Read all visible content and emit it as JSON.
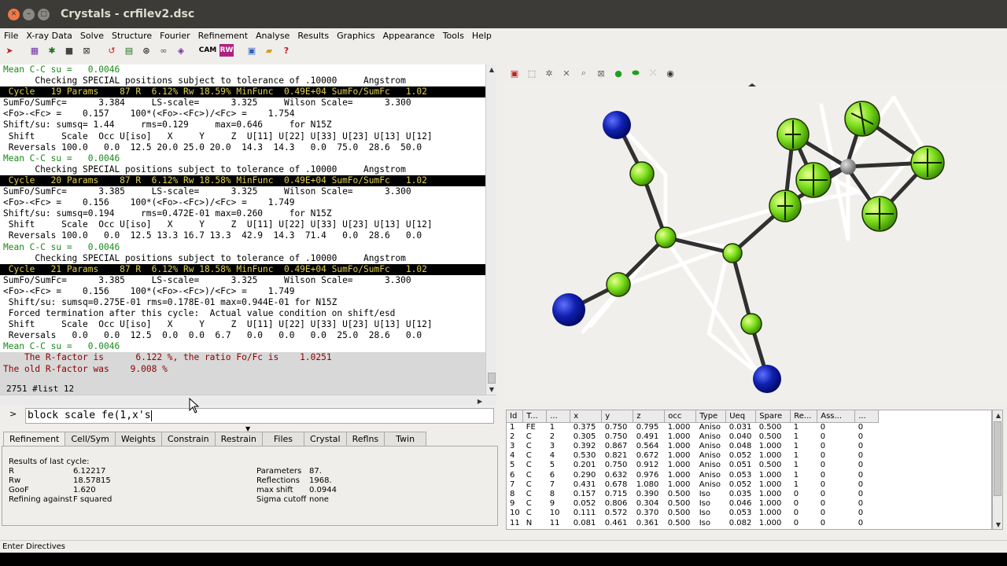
{
  "window": {
    "title": "Crystals - crfilev2.dsc"
  },
  "menu": [
    "File",
    "X-ray Data",
    "Solve",
    "Structure",
    "Fourier",
    "Refinement",
    "Analyse",
    "Results",
    "Graphics",
    "Appearance",
    "Tools",
    "Help"
  ],
  "toolbar_icons": [
    "arrow-icon",
    "grid-icon",
    "atoms-icon",
    "stop-icon",
    "cancel-icon",
    "undo-icon",
    "script-icon",
    "rings-icon",
    "link-icon",
    "molecule-icon",
    "cam-icon",
    "rw-icon",
    "view-icon",
    "folder-icon",
    "help-icon"
  ],
  "toolbar_text": {
    "cam": "CAM",
    "rw": "RW"
  },
  "output_lines": [
    {
      "t": "Mean C-C su =   0.0046",
      "c": "green"
    },
    {
      "t": "      Checking SPECIAL positions subject to tolerance of .10000     Angstrom",
      "c": ""
    },
    {
      "t": " Cycle   19 Params    87 R  6.12% Rw 18.59% MinFunc  0.49E+04 SumFo/SumFc   1.02",
      "c": "cycle"
    },
    {
      "t": "SumFo/SumFc=      3.384     LS-scale=      3.325     Wilson Scale=      3.300",
      "c": ""
    },
    {
      "t": "<Fo>-<Fc> =    0.157    100*(<Fo>-<Fc>)/<Fc> =    1.754",
      "c": ""
    },
    {
      "t": "Shift/su: sumsq= 1.44     rms=0.129     max=0.646     for N15Z",
      "c": ""
    },
    {
      "t": " Shift     Scale  Occ U[iso]   X     Y     Z  U[11] U[22] U[33] U[23] U[13] U[12]",
      "c": ""
    },
    {
      "t": " Reversals 100.0   0.0  12.5 20.0 25.0 20.0  14.3  14.3   0.0  75.0  28.6  50.0",
      "c": ""
    },
    {
      "t": "Mean C-C su =   0.0046",
      "c": "green"
    },
    {
      "t": "      Checking SPECIAL positions subject to tolerance of .10000     Angstrom",
      "c": ""
    },
    {
      "t": " Cycle   20 Params    87 R  6.12% Rw 18.58% MinFunc  0.49E+04 SumFo/SumFc   1.02",
      "c": "cycle"
    },
    {
      "t": "SumFo/SumFc=      3.385     LS-scale=      3.325     Wilson Scale=      3.300",
      "c": ""
    },
    {
      "t": "<Fo>-<Fc> =    0.156    100*(<Fo>-<Fc>)/<Fc> =    1.749",
      "c": ""
    },
    {
      "t": "Shift/su: sumsq=0.194     rms=0.472E-01 max=0.260     for N15Z",
      "c": ""
    },
    {
      "t": " Shift     Scale  Occ U[iso]   X     Y     Z  U[11] U[22] U[33] U[23] U[13] U[12]",
      "c": ""
    },
    {
      "t": " Reversals 100.0   0.0  12.5 13.3 16.7 13.3  42.9  14.3  71.4   0.0  28.6   0.0",
      "c": ""
    },
    {
      "t": "Mean C-C su =   0.0046",
      "c": "green"
    },
    {
      "t": "      Checking SPECIAL positions subject to tolerance of .10000     Angstrom",
      "c": ""
    },
    {
      "t": " Cycle   21 Params    87 R  6.12% Rw 18.58% MinFunc  0.49E+04 SumFo/SumFc   1.02",
      "c": "cycle"
    },
    {
      "t": "SumFo/SumFc=      3.385     LS-scale=      3.325     Wilson Scale=      3.300",
      "c": ""
    },
    {
      "t": "<Fo>-<Fc> =    0.156    100*(<Fo>-<Fc>)/<Fc> =    1.749",
      "c": ""
    },
    {
      "t": " Shift/su: sumsq=0.275E-01 rms=0.178E-01 max=0.944E-01 for N15Z",
      "c": ""
    },
    {
      "t": " Forced termination after this cycle:  Actual value condition on shift/esd",
      "c": ""
    },
    {
      "t": " Shift     Scale  Occ U[iso]   X     Y     Z  U[11] U[22] U[33] U[23] U[13] U[12]",
      "c": ""
    },
    {
      "t": " Reversals   0.0   0.0  12.5  0.0  0.0  6.7   0.0   0.0   0.0  25.0  28.6   0.0",
      "c": ""
    },
    {
      "t": "Mean C-C su =   0.0046",
      "c": "green"
    },
    {
      "t": "    The R-factor is      6.122 %, the ratio Fo/Fc is    1.0251",
      "c": "red"
    },
    {
      "t": "The old R-factor was    9.008 %",
      "c": "red"
    },
    {
      "t": "",
      "c": "gray"
    }
  ],
  "status_line": "2751 #list 12",
  "command": {
    "prompt": ">",
    "value": "block scale fe(1,x's"
  },
  "tabs": [
    "Refinement",
    "Cell/Sym",
    "Weights",
    "Constrain",
    "Restrain",
    "Files",
    "Crystal",
    "Reflns",
    "Twin"
  ],
  "results": {
    "title": "Results of last cycle:",
    "left": [
      {
        "k": "R",
        "v": "6.12217"
      },
      {
        "k": "Rw",
        "v": "18.57815"
      },
      {
        "k": "GooF",
        "v": "1.620"
      },
      {
        "k": "Refining against",
        "v": "F squared"
      }
    ],
    "right": [
      {
        "k": "Parameters",
        "v": "87."
      },
      {
        "k": "Reflections",
        "v": "1968."
      },
      {
        "k": "max shift",
        "v": "0.0944"
      },
      {
        "k": "Sigma cutoff",
        "v": "none"
      }
    ]
  },
  "atom_table": {
    "headers": [
      "Id",
      "T...",
      "...",
      "x",
      "y",
      "z",
      "occ",
      "Type",
      "Ueq",
      "Spare",
      "Re...",
      "Ass...",
      "..."
    ],
    "rows": [
      [
        "1",
        "FE",
        "1",
        "0.375",
        "0.750",
        "0.795",
        "1.000",
        "Aniso",
        "0.031",
        "0.500",
        "1",
        "0",
        "0"
      ],
      [
        "2",
        "C",
        "2",
        "0.305",
        "0.750",
        "0.491",
        "1.000",
        "Aniso",
        "0.040",
        "0.500",
        "1",
        "0",
        "0"
      ],
      [
        "3",
        "C",
        "3",
        "0.392",
        "0.867",
        "0.564",
        "1.000",
        "Aniso",
        "0.048",
        "1.000",
        "1",
        "0",
        "0"
      ],
      [
        "4",
        "C",
        "4",
        "0.530",
        "0.821",
        "0.672",
        "1.000",
        "Aniso",
        "0.052",
        "1.000",
        "1",
        "0",
        "0"
      ],
      [
        "5",
        "C",
        "5",
        "0.201",
        "0.750",
        "0.912",
        "1.000",
        "Aniso",
        "0.051",
        "0.500",
        "1",
        "0",
        "0"
      ],
      [
        "6",
        "C",
        "6",
        "0.290",
        "0.632",
        "0.976",
        "1.000",
        "Aniso",
        "0.053",
        "1.000",
        "1",
        "0",
        "0"
      ],
      [
        "7",
        "C",
        "7",
        "0.431",
        "0.678",
        "1.080",
        "1.000",
        "Aniso",
        "0.052",
        "1.000",
        "1",
        "0",
        "0"
      ],
      [
        "8",
        "C",
        "8",
        "0.157",
        "0.715",
        "0.390",
        "0.500",
        "Iso",
        "0.035",
        "1.000",
        "0",
        "0",
        "0"
      ],
      [
        "9",
        "C",
        "9",
        "0.052",
        "0.806",
        "0.304",
        "0.500",
        "Iso",
        "0.046",
        "1.000",
        "0",
        "0",
        "0"
      ],
      [
        "10",
        "C",
        "10",
        "0.111",
        "0.572",
        "0.370",
        "0.500",
        "Iso",
        "0.053",
        "1.000",
        "0",
        "0",
        "0"
      ],
      [
        "11",
        "N",
        "11",
        "0.081",
        "0.461",
        "0.361",
        "0.500",
        "Iso",
        "0.082",
        "1.000",
        "0",
        "0",
        "0"
      ]
    ]
  },
  "statusbar": "Enter Directives",
  "colors": {
    "carbon": "#7ee020",
    "nitrogen": "#1020b0",
    "iron": "#888888",
    "bond_dark": "#303030",
    "bond_light": "#ffffff"
  }
}
